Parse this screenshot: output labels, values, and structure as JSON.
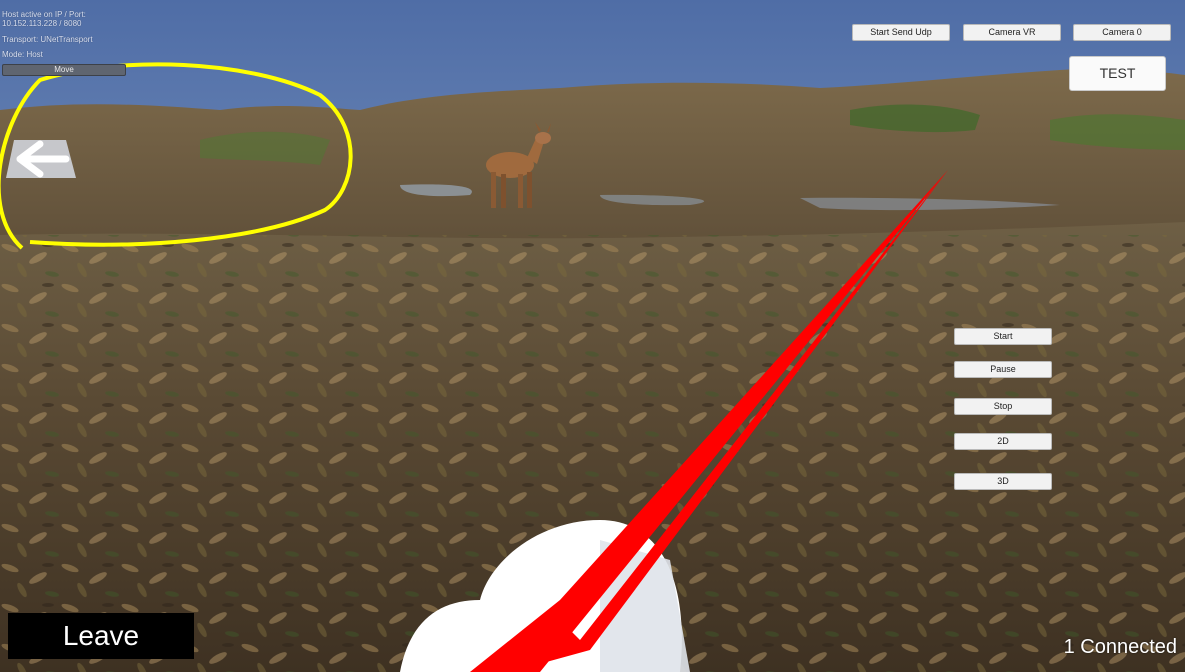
{
  "status": {
    "host_line": "Host active on IP / Port:",
    "address": "10.152.113.228 / 8080",
    "transport": "Transport: UNetTransport",
    "mode": "Mode: Host"
  },
  "buttons": {
    "move": "Move",
    "start_send_udp": "Start Send Udp",
    "camera_vr": "Camera VR",
    "camera_0": "Camera 0",
    "test": "TEST",
    "start": "Start",
    "pause": "Pause",
    "stop": "Stop",
    "mode_2d": "2D",
    "mode_3d": "3D",
    "leave": "Leave"
  },
  "connection_status": "1 Connected",
  "icons": {
    "back_arrow": "arrow-left-icon"
  },
  "colors": {
    "sky": "#5d79ad",
    "laser": "#ff0000",
    "highlight": "#ffff00",
    "leave_bg": "#000000"
  }
}
